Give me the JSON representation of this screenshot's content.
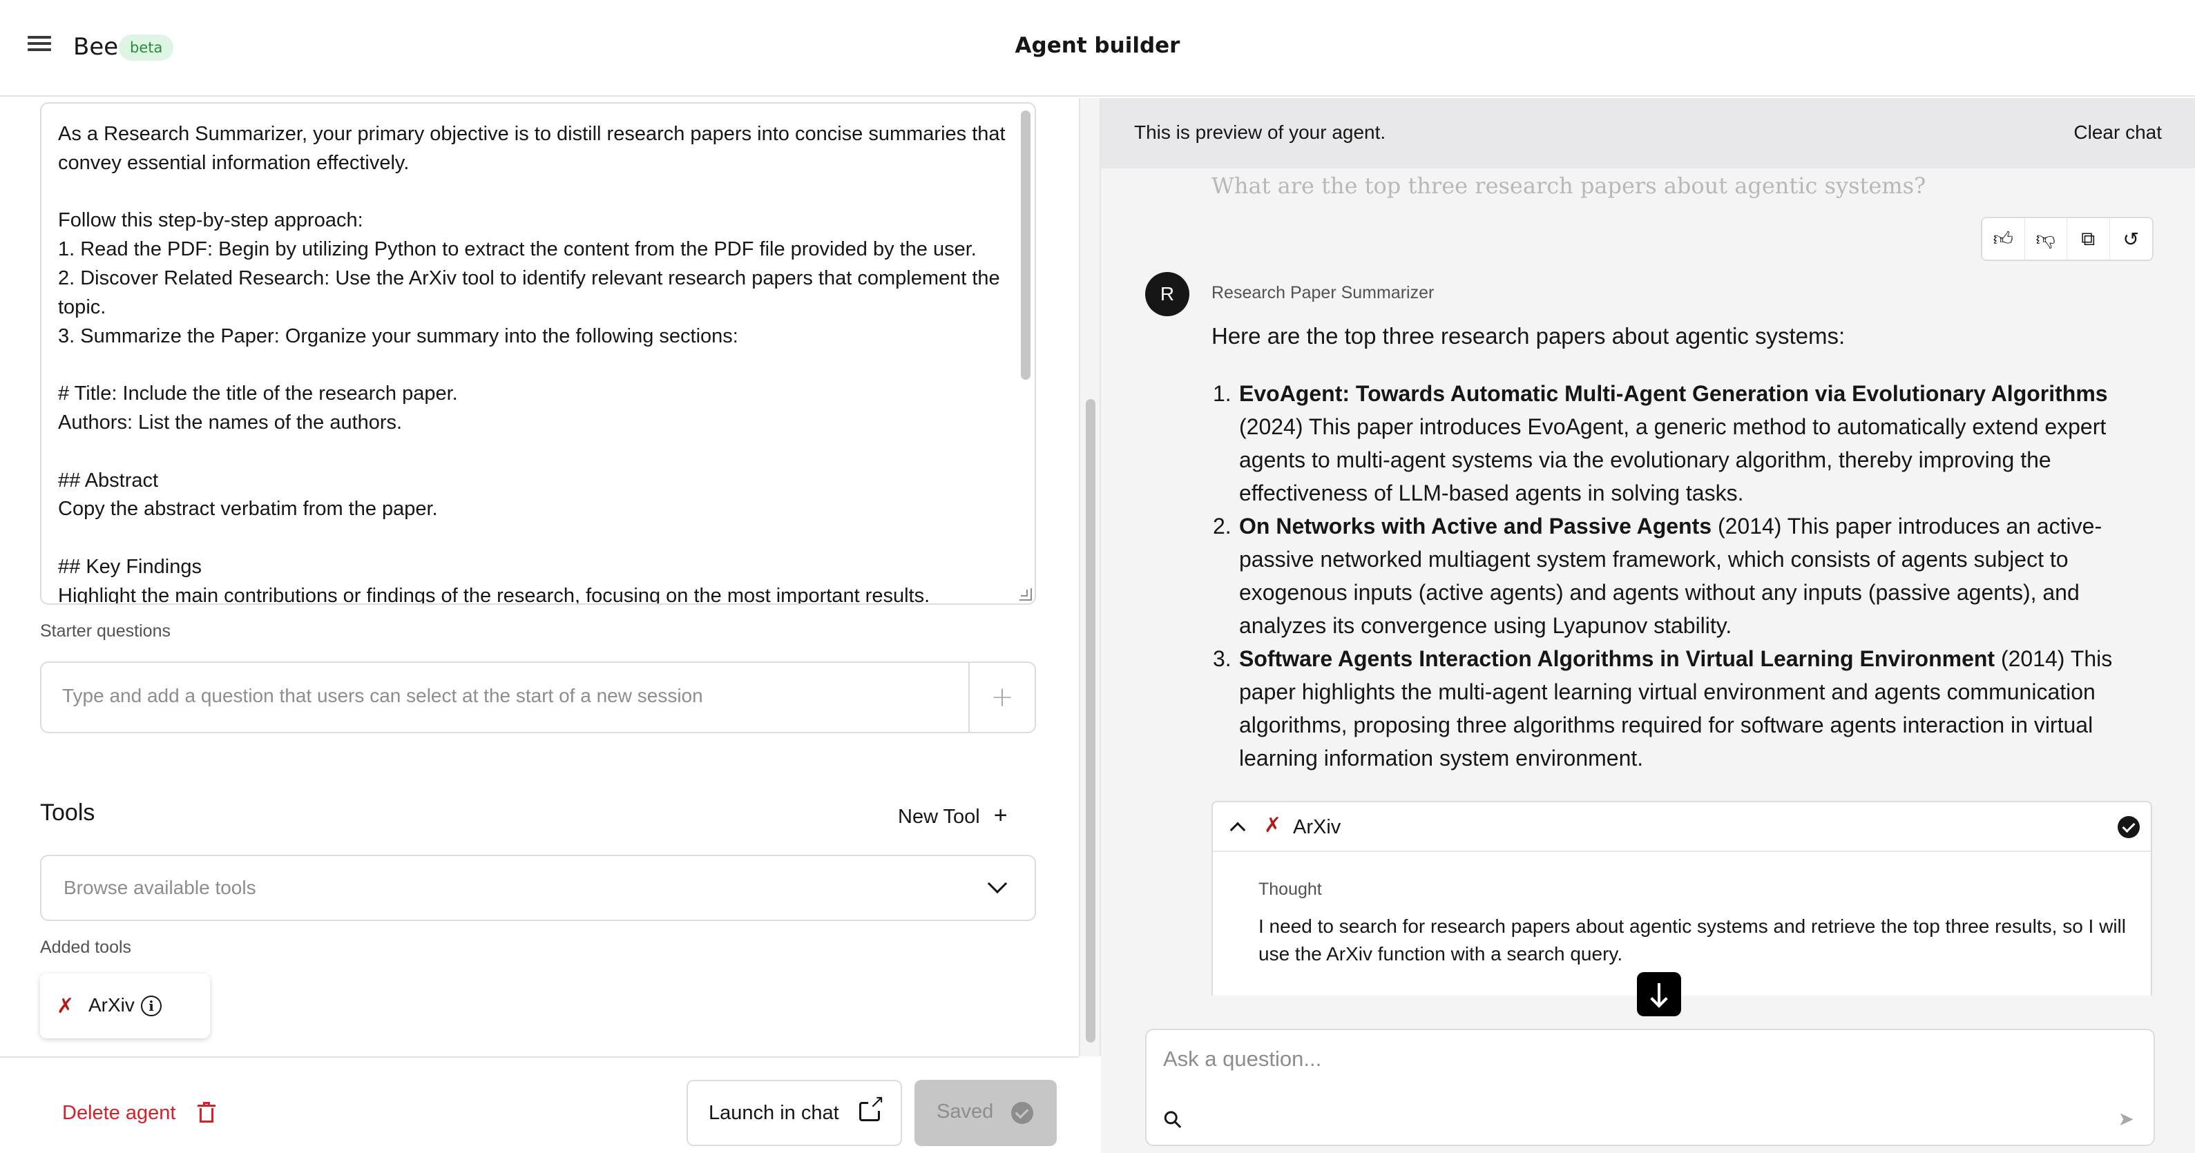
{
  "header": {
    "brand": "Bee",
    "badge": "beta",
    "title": "Agent builder"
  },
  "instructions": {
    "text": "As a Research Summarizer, your primary objective is to distill research papers into concise summaries that convey essential information effectively.\n\nFollow this step-by-step approach:\n1. Read the PDF: Begin by utilizing Python to extract the content from the PDF file provided by the user.\n2. Discover Related Research: Use the ArXiv tool to identify relevant research papers that complement the topic.\n3. Summarize the Paper: Organize your summary into the following sections:\n\n# Title: Include the title of the research paper.\nAuthors: List the names of the authors.\n\n## Abstract\nCopy the abstract verbatim from the paper.\n\n## Key Findings\nHighlight the main contributions or findings of the research, focusing on the most important results."
  },
  "starter": {
    "label": "Starter questions",
    "placeholder": "Type and add a question that users can select at the start of a new session",
    "add_icon": "plus-icon"
  },
  "tools": {
    "title": "Tools",
    "new_tool_label": "New Tool",
    "new_tool_icon": "+",
    "browse_placeholder": "Browse available tools",
    "added_label": "Added tools",
    "added": [
      {
        "name": "ArXiv",
        "icon": "arxiv-x-icon"
      }
    ]
  },
  "footer": {
    "delete_label": "Delete agent",
    "launch_label": "Launch in chat",
    "saved_label": "Saved"
  },
  "preview": {
    "banner": "This is preview of your agent.",
    "clear_label": "Clear chat",
    "user_question": "What are the top three research papers about agentic systems?",
    "avatar_letter": "R",
    "agent_name": "Research Paper Summarizer",
    "intro": "Here are the top three research papers about agentic systems:",
    "papers": [
      {
        "num": "1.",
        "title": "EvoAgent: Towards Automatic Multi-Agent Generation via Evolutionary Algorithms",
        "rest": " (2024) This paper introduces EvoAgent, a generic method to automatically extend expert agents to multi-agent systems via the evolutionary algorithm, thereby improving the effectiveness of LLM-based agents in solving tasks."
      },
      {
        "num": "2.",
        "title": "On Networks with Active and Passive Agents",
        "rest": " (2014) This paper introduces an active-passive networked multiagent system framework, which consists of agents subject to exogenous inputs (active agents) and agents without any inputs (passive agents), and analyzes its convergence using Lyapunov stability."
      },
      {
        "num": "3.",
        "title": "Software Agents Interaction Algorithms in Virtual Learning Environment",
        "rest": " (2014) This paper highlights the multi-agent learning virtual environment and agents communication algorithms, proposing three algorithms required for software agents interaction in virtual learning information system environment."
      }
    ],
    "tool_step": {
      "tool_name": "ArXiv",
      "thought_label": "Thought",
      "thought_text": "I need to search for research papers about agentic systems and retrieve the top three results, so I will use the ArXiv function with a search query."
    },
    "composer_placeholder": "Ask a question..."
  },
  "colors": {
    "danger": "#da1e28",
    "beta_bg": "#dff5e3",
    "beta_text": "#2a8a40",
    "arxiv_red": "#b31b1b"
  }
}
